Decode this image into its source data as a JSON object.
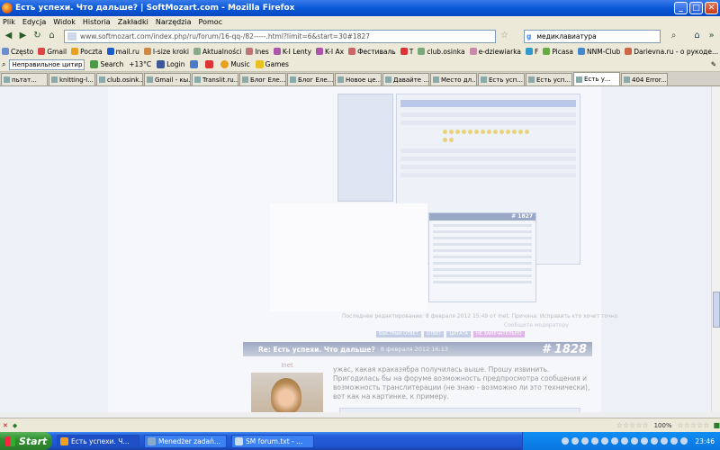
{
  "window": {
    "title": "Есть успехи. Что дальше? | SoftMozart.com - Mozilla Firefox"
  },
  "menu": {
    "items": [
      "Plik",
      "Edycja",
      "Widok",
      "Historia",
      "Zakładki",
      "Narzędzia",
      "Pomoc"
    ]
  },
  "nav": {
    "url": "www.softmozart.com/index.php/ru/forum/16-qq-/82-----.html?limit=6&start=30#1827",
    "search_value": "медиклавиатура"
  },
  "bookmarks": [
    {
      "label": "Często",
      "color": "#6a8fd0"
    },
    {
      "label": "Gmail",
      "color": "#d44"
    },
    {
      "label": "Poczta",
      "color": "#e8a020"
    },
    {
      "label": "mail.ru",
      "color": "#1b5cc8"
    },
    {
      "label": "I-size kroki",
      "color": "#c84"
    },
    {
      "label": "Aktualności",
      "color": "#8a8"
    },
    {
      "label": "Ines",
      "color": "#b77"
    },
    {
      "label": "K-I Lenty",
      "color": "#a5a"
    },
    {
      "label": "K-I Ax",
      "color": "#a5a"
    },
    {
      "label": "Фестиваль",
      "color": "#c66"
    },
    {
      "label": "T",
      "color": "#d33"
    },
    {
      "label": "club.osinka",
      "color": "#7a7"
    },
    {
      "label": "e-dziewiarka",
      "color": "#c8a"
    },
    {
      "label": "F",
      "color": "#39c"
    },
    {
      "label": "Picasa",
      "color": "#6a4"
    },
    {
      "label": "NNM-Club",
      "color": "#48c"
    },
    {
      "label": "Darievna.ru - о рукоде...",
      "color": "#c64"
    }
  ],
  "toolbar2": {
    "select_value": "Неправильное цитир",
    "search_label": "Search",
    "temperature": "+13°C",
    "login_label": "Login",
    "music_label": "Music",
    "games_label": "Games"
  },
  "tabs": [
    {
      "label": "пьтат...",
      "active": false
    },
    {
      "label": "knitting-l...",
      "active": false
    },
    {
      "label": "club.osink...",
      "active": false
    },
    {
      "label": "Gmail - кы...",
      "active": false
    },
    {
      "label": "Translit.ru...",
      "active": false
    },
    {
      "label": "Блог Еле...",
      "active": false
    },
    {
      "label": "Блог Еле...",
      "active": false
    },
    {
      "label": "Новое це...",
      "active": false
    },
    {
      "label": "Давайте ...",
      "active": false
    },
    {
      "label": "Место дл...",
      "active": false
    },
    {
      "label": "Есть усп...",
      "active": false
    },
    {
      "label": "Есть усп...",
      "active": false
    },
    {
      "label": "Есть у...",
      "active": true
    },
    {
      "label": "404 Error...",
      "active": false
    }
  ],
  "forum": {
    "subshot_number": "# 1827",
    "edit_note": "Последнее редактирование: 8 февраля 2012 15:49 от Inet. Причина: Исправить кто хочет точно",
    "sig_note": "Сообщите модератору",
    "actions": [
      "БЫСТРЫЙ ОТВЕТ",
      "ОТВЕТ",
      "ЦИТАТА",
      "НЕ ЗАМЕЧАТЕЛЬНО"
    ],
    "post": {
      "title": "Re: Есть успехи. Что дальше?",
      "date": "8 февраля 2012 16:13",
      "number": "# 1828",
      "author": "Inet",
      "text": "ужас, какая краказябра получилась выше. Прошу извинить. Пригодилась бы на форуме возможность предпросмотра сообщения и возможность транслитерации (не знаю - возможно ли это технически), вот как на картинке, к примеру."
    }
  },
  "status": {
    "zoom": "100%"
  },
  "taskbar": {
    "start_label": "Start",
    "tasks": [
      {
        "label": "Есть успехи. Ч...",
        "active": true
      },
      {
        "label": "Menedżer zadań...",
        "active": false
      },
      {
        "label": "SM forum.txt - ...",
        "active": false
      }
    ],
    "clock": "23:46"
  }
}
